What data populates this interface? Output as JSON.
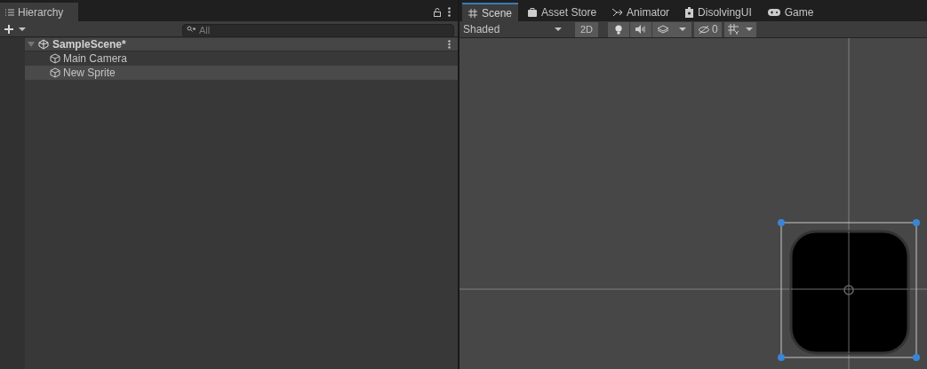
{
  "hierarchy": {
    "tab": {
      "label": "Hierarchy"
    },
    "search": {
      "placeholder": "All"
    },
    "tree": [
      {
        "label": "SampleScene*",
        "expanded": true,
        "children": [
          {
            "label": "Main Camera",
            "selected": false
          },
          {
            "label": "New Sprite",
            "selected": true
          }
        ]
      }
    ]
  },
  "scene": {
    "tabs": [
      {
        "label": "Scene",
        "kind": "grid",
        "selected": true
      },
      {
        "label": "Asset Store",
        "kind": "bag",
        "selected": false
      },
      {
        "label": "Animator",
        "kind": "fork",
        "selected": false
      },
      {
        "label": "DisolvingUI",
        "kind": "device",
        "selected": false
      },
      {
        "label": "Game",
        "kind": "gamepad",
        "selected": false
      }
    ],
    "toolbar": {
      "draw_mode": "Shaded",
      "mode_2d": "2D",
      "hidden_count": "0"
    }
  }
}
